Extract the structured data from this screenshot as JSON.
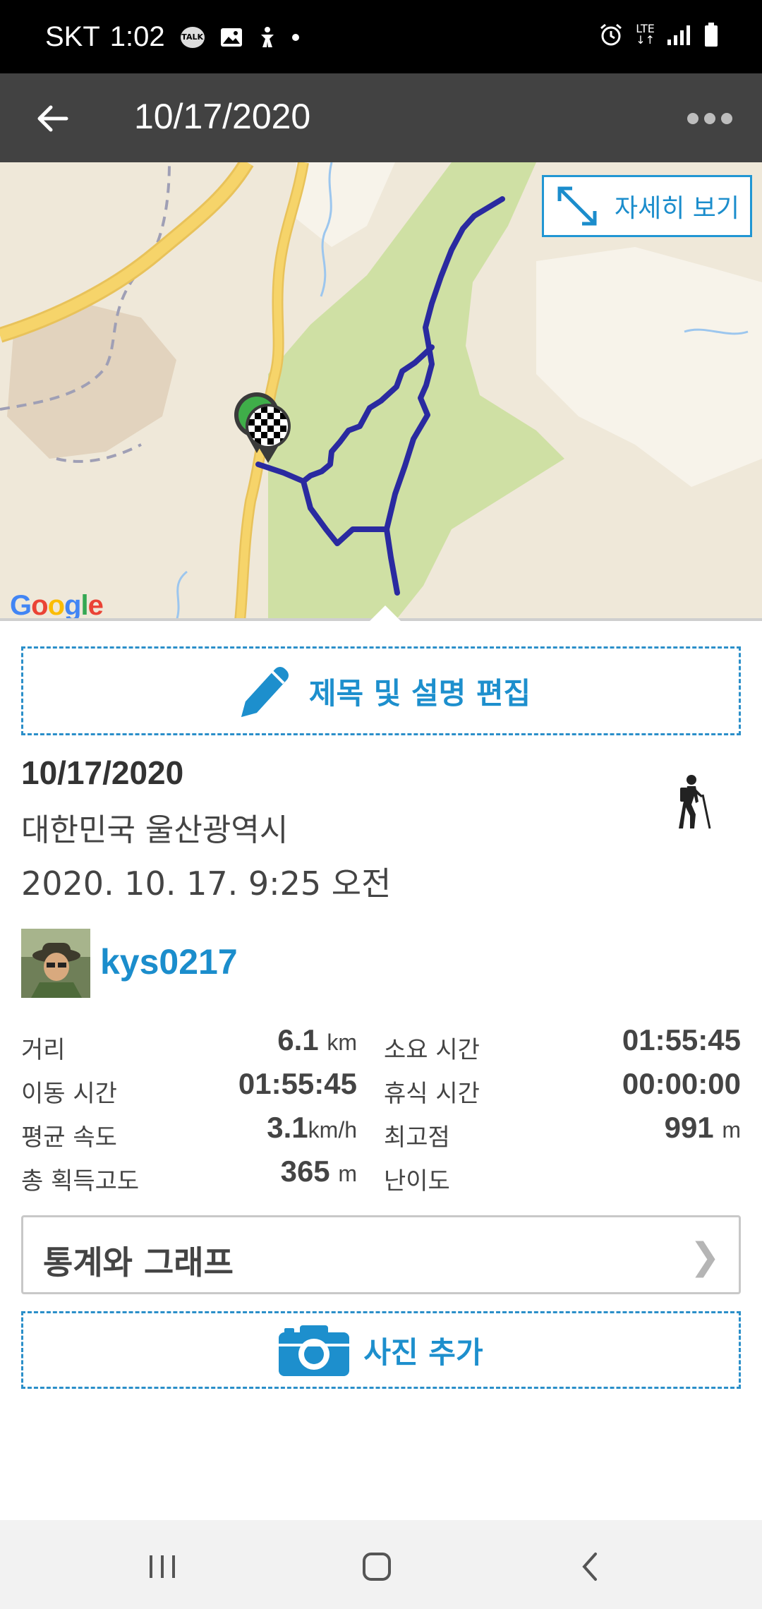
{
  "status_bar": {
    "carrier": "SKT",
    "time": "1:02",
    "left_icons": [
      "talk-icon",
      "image-icon",
      "accessibility-icon",
      "dot-icon"
    ],
    "right_icons": [
      "alarm-icon",
      "lte-icon",
      "signal-icon",
      "battery-icon"
    ],
    "talk_badge": "TALK",
    "lte_label": "LTE"
  },
  "app_bar": {
    "title": "10/17/2020"
  },
  "map": {
    "detail_button_label": "자세히 보기",
    "logo_letters": [
      "G",
      "o",
      "o",
      "g",
      "l",
      "e"
    ],
    "route_color": "#2a2aa0",
    "forest_color": "#cfe0a4",
    "road_color": "#f6d46a"
  },
  "edit_button": {
    "label": "제목 및 설명 편집"
  },
  "track": {
    "title": "10/17/2020",
    "location": "대한민국 울산광역시",
    "datetime": "2020. 10. 17. 9:25 오전",
    "activity_icon": "hiker-icon"
  },
  "user": {
    "name": "kys0217"
  },
  "stats": {
    "distance_label": "거리",
    "distance_value": "6.1",
    "distance_unit": "km",
    "duration_label": "소요 시간",
    "duration_value": "01:55:45",
    "moving_label": "이동 시간",
    "moving_value": "01:55:45",
    "rest_label": "휴식 시간",
    "rest_value": "00:00:00",
    "speed_label": "평균 속도",
    "speed_value": "3.1",
    "speed_unit": "km/h",
    "max_alt_label": "최고점",
    "max_alt_value": "991",
    "max_alt_unit": "m",
    "gain_label": "총 획득고도",
    "gain_value": "365",
    "gain_unit": "m",
    "difficulty_label": "난이도"
  },
  "stats_graph_button": {
    "label": "통계와 그래프",
    "chevron": "❯"
  },
  "photo_button": {
    "label": "사진 추가"
  },
  "colors": {
    "accent": "#1b8dcc",
    "app_bar": "#424242",
    "status_bar": "#000000"
  }
}
